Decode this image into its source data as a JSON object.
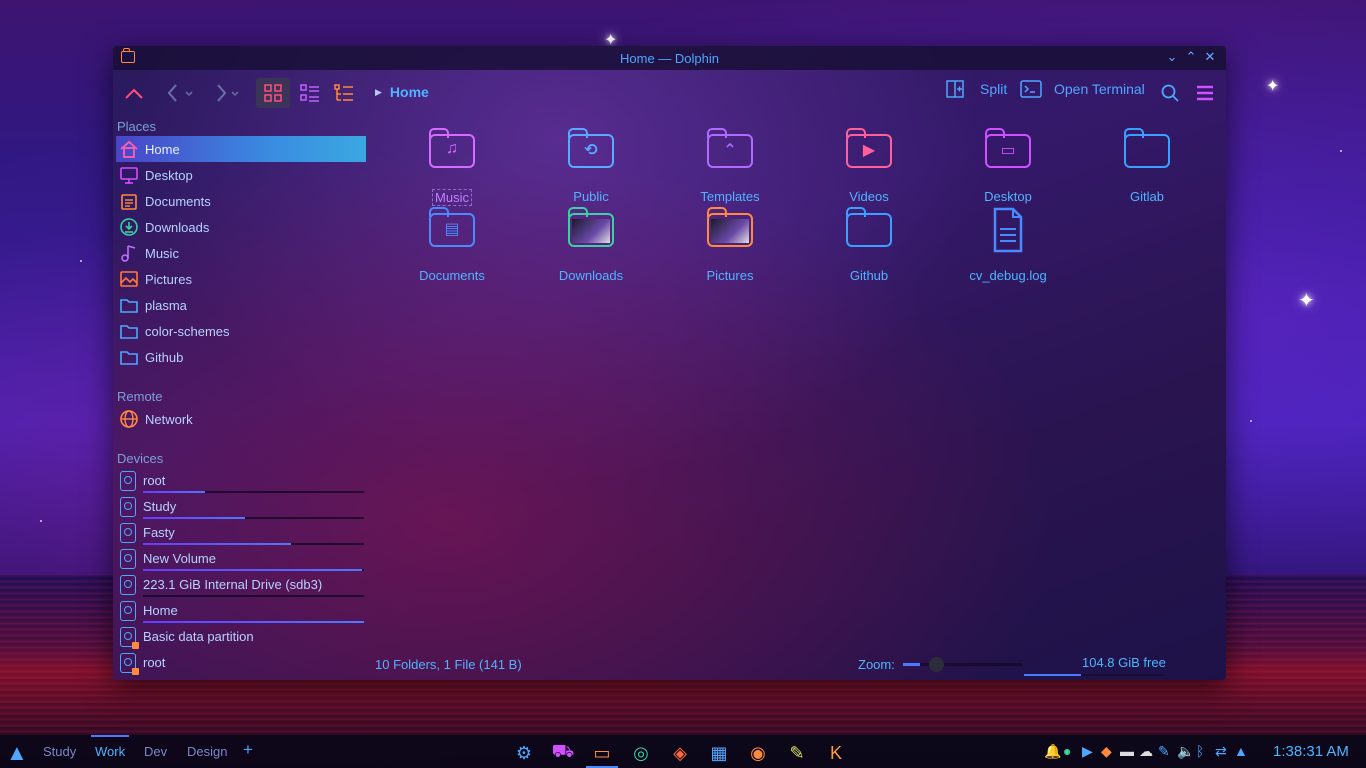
{
  "window": {
    "title": "Home — Dolphin",
    "controls": {
      "minimize": "⌄",
      "maximize": "⌃",
      "close": "✕"
    }
  },
  "toolbar": {
    "breadcrumb": "Home",
    "split_label": "Split",
    "terminal_label": "Open Terminal"
  },
  "sidebar": {
    "places_header": "Places",
    "places": [
      {
        "label": "Home",
        "icon": "home-icon",
        "color": "#ff5fb0"
      },
      {
        "label": "Desktop",
        "icon": "desktop-icon",
        "color": "#d050ff"
      },
      {
        "label": "Documents",
        "icon": "documents-icon",
        "color": "#ff8a3d"
      },
      {
        "label": "Downloads",
        "icon": "download-icon",
        "color": "#3ad0a0"
      },
      {
        "label": "Music",
        "icon": "music-icon",
        "color": "#c070ff"
      },
      {
        "label": "Pictures",
        "icon": "pictures-icon",
        "color": "#ff7a3d"
      },
      {
        "label": "plasma",
        "icon": "folder-icon",
        "color": "#4fa6ff"
      },
      {
        "label": "color-schemes",
        "icon": "folder-icon",
        "color": "#4fa6ff"
      },
      {
        "label": "Github",
        "icon": "folder-icon",
        "color": "#4fa6ff"
      }
    ],
    "remote_header": "Remote",
    "remote": [
      {
        "label": "Network",
        "icon": "network-icon",
        "color": "#ff8a3d"
      }
    ],
    "devices_header": "Devices",
    "devices": [
      {
        "label": "root",
        "usage": 0.28,
        "removable": false
      },
      {
        "label": "Study",
        "usage": 0.46,
        "removable": false
      },
      {
        "label": "Fasty",
        "usage": 0.67,
        "removable": false
      },
      {
        "label": "New Volume",
        "usage": 0.99,
        "removable": false
      },
      {
        "label": "223.1 GiB Internal Drive (sdb3)",
        "usage": 0.0,
        "removable": false
      },
      {
        "label": "Home",
        "usage": 1.0,
        "removable": false
      },
      {
        "label": "Basic data partition",
        "usage": null,
        "removable": true
      },
      {
        "label": "root",
        "usage": null,
        "removable": true
      }
    ]
  },
  "files": [
    {
      "name": "Music",
      "kind": "folder",
      "icon": "music-folder-icon",
      "glyph": "♫",
      "color": "#d86aff"
    },
    {
      "name": "Public",
      "kind": "folder",
      "icon": "public-folder-icon",
      "glyph": "⟲",
      "color": "#5aa8ff"
    },
    {
      "name": "Templates",
      "kind": "folder",
      "icon": "templates-folder-icon",
      "glyph": "⌃",
      "color": "#b06aff"
    },
    {
      "name": "Videos",
      "kind": "folder",
      "icon": "videos-folder-icon",
      "glyph": "▶",
      "color": "#ff5f9a"
    },
    {
      "name": "Desktop",
      "kind": "folder",
      "icon": "desktop-folder-icon",
      "glyph": "▭",
      "color": "#d050ff"
    },
    {
      "name": "Gitlab",
      "kind": "folder",
      "icon": "folder-icon",
      "glyph": "",
      "color": "#3aa0ff"
    },
    {
      "name": "Documents",
      "kind": "folder",
      "icon": "documents-folder-icon",
      "glyph": "▤",
      "color": "#4a8aff"
    },
    {
      "name": "Downloads",
      "kind": "folder-thumb",
      "icon": "downloads-folder-icon",
      "glyph": "",
      "color": "#3ad0a0"
    },
    {
      "name": "Pictures",
      "kind": "folder-thumb",
      "icon": "pictures-folder-icon",
      "glyph": "",
      "color": "#ff8a3d"
    },
    {
      "name": "Github",
      "kind": "folder",
      "icon": "folder-icon",
      "glyph": "",
      "color": "#3aa0ff"
    },
    {
      "name": "cv_debug.log",
      "kind": "file",
      "icon": "text-file-icon",
      "glyph": "≡",
      "color": "#4a8aff"
    }
  ],
  "status": {
    "summary": "10 Folders, 1 File (141 B)",
    "zoom_label": "Zoom:",
    "zoom_level": 0.14,
    "free_space": "104.8 GiB free",
    "free_usage": 0.41
  },
  "taskbar": {
    "desktops": [
      {
        "label": "Study",
        "active": false
      },
      {
        "label": "Work",
        "active": true
      },
      {
        "label": "Dev",
        "active": false
      },
      {
        "label": "Design",
        "active": false
      }
    ],
    "add_desktop": "+",
    "tasks": [
      {
        "icon": "settings-icon",
        "glyph": "⚙",
        "color": "#4fa6ff",
        "active": false
      },
      {
        "icon": "store-icon",
        "glyph": "⛟",
        "color": "#d050ff",
        "active": false
      },
      {
        "icon": "files-icon",
        "glyph": "▭",
        "color": "#ff8a3d",
        "active": true
      },
      {
        "icon": "chromium-icon",
        "glyph": "◎",
        "color": "#3ad0a0",
        "active": false
      },
      {
        "icon": "brave-icon",
        "glyph": "◈",
        "color": "#ff6a3d",
        "active": false
      },
      {
        "icon": "monitor-icon",
        "glyph": "▦",
        "color": "#4fa6ff",
        "active": false
      },
      {
        "icon": "chrome-icon",
        "glyph": "◉",
        "color": "#ff8a3d",
        "active": false
      },
      {
        "icon": "krita-icon",
        "glyph": "✎",
        "color": "#e0e060",
        "active": false
      },
      {
        "icon": "kdenlive-icon",
        "glyph": "K",
        "color": "#ff9a3d",
        "active": false
      }
    ],
    "tray": [
      {
        "icon": "notifications-icon",
        "glyph": "🔔",
        "color": "#4fa6ff"
      },
      {
        "icon": "bluetooth-app-icon",
        "glyph": "●",
        "color": "#3ad0a0"
      },
      {
        "icon": "media-play-icon",
        "glyph": "▶",
        "color": "#4fa6ff"
      },
      {
        "icon": "color-app-icon",
        "glyph": "◆",
        "color": "#ff8a3d"
      },
      {
        "icon": "drive-icon",
        "glyph": "▬",
        "color": "#dddddd"
      },
      {
        "icon": "cloud-icon",
        "glyph": "☁",
        "color": "#dddddd"
      },
      {
        "icon": "clip-icon",
        "glyph": "✎",
        "color": "#4fa6ff"
      },
      {
        "icon": "volume-icon",
        "glyph": "🔈",
        "color": "#4fa6ff"
      },
      {
        "icon": "bluetooth-icon",
        "glyph": "ᛒ",
        "color": "#4fa6ff"
      },
      {
        "icon": "network-icon",
        "glyph": "⇄",
        "color": "#4fa6ff"
      },
      {
        "icon": "expand-tray-icon",
        "glyph": "▲",
        "color": "#4fa6ff"
      }
    ],
    "clock": "1:38:31 AM"
  }
}
